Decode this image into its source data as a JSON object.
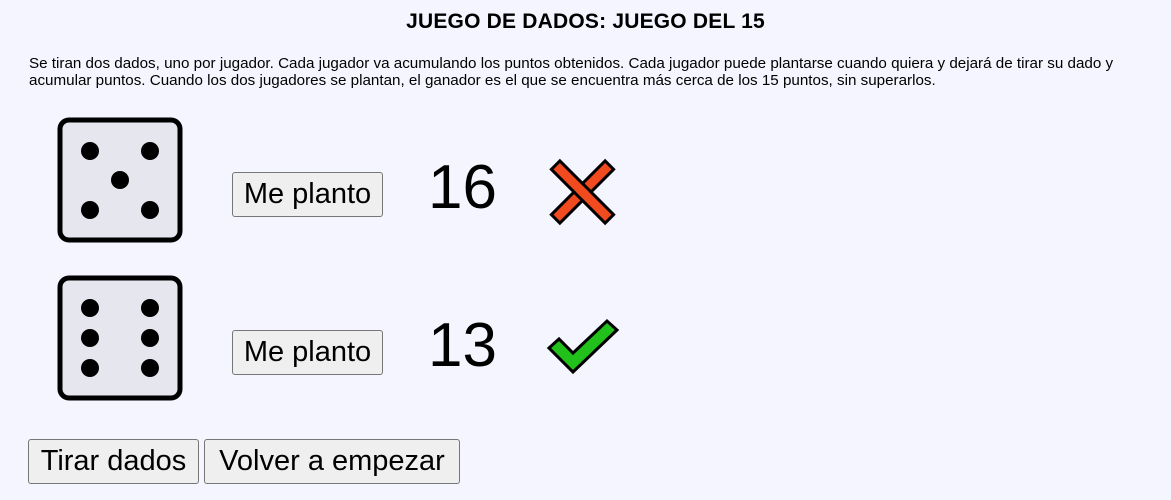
{
  "header": {
    "title": "JUEGO DE DADOS: JUEGO DEL 15"
  },
  "description": "Se tiran dos dados, uno por jugador. Cada jugador va acumulando los puntos obtenidos. Cada jugador puede plantarse cuando quiera y dejará de tirar su dado y acumular puntos. Cuando los dos jugadores se plantan, el ganador es el que se encuentra más cerca de los 15 puntos, sin superarlos.",
  "players": [
    {
      "die_value": 5,
      "die_icon": "die-five-icon",
      "stand_label": "Me planto",
      "score": "16",
      "status_icon": "cross-icon",
      "status_color": "#f04a1e"
    },
    {
      "die_value": 6,
      "die_icon": "die-six-icon",
      "stand_label": "Me planto",
      "score": "13",
      "status_icon": "check-icon",
      "status_color": "#22c01a"
    }
  ],
  "controls": {
    "roll_label": "Tirar dados",
    "restart_label": "Volver a empezar"
  }
}
